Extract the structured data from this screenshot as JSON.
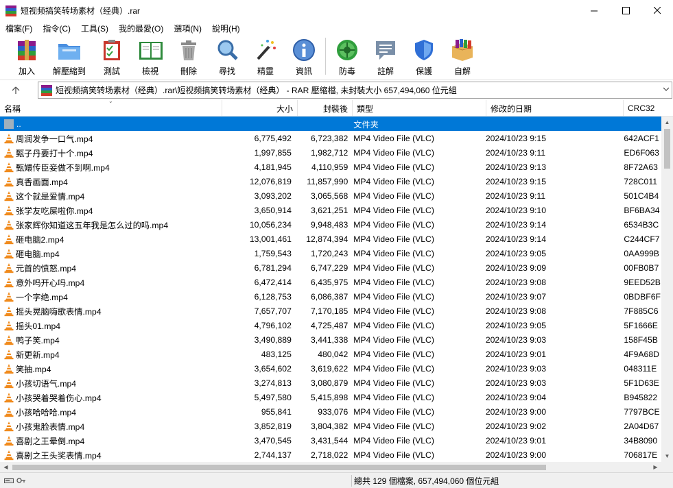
{
  "window": {
    "title": "短视频搞笑转场素材（经典）.rar",
    "minimize": "—",
    "maximize": "☐",
    "close": "✕"
  },
  "menu": [
    "檔案(F)",
    "指令(C)",
    "工具(S)",
    "我的最愛(O)",
    "選項(N)",
    "說明(H)"
  ],
  "toolbar": {
    "add": "加入",
    "extract": "解壓縮到",
    "test": "測試",
    "view": "檢視",
    "delete": "刪除",
    "find": "尋找",
    "wizard": "精靈",
    "info": "資訊",
    "virus": "防毒",
    "comment": "註解",
    "protect": "保護",
    "sfx": "自解"
  },
  "address": {
    "text": "短视频搞笑转场素材（经典）.rar\\短视频搞笑转场素材（经典） - RAR 壓縮檔, 未封裝大小 657,494,060 位元組"
  },
  "columns": {
    "name": "名稱",
    "size": "大小",
    "packed": "封裝後",
    "type": "類型",
    "modified": "修改的日期",
    "crc": "CRC32"
  },
  "parent_row": {
    "name": "..",
    "type": "文件夹"
  },
  "files": [
    {
      "name": "周润发争一口气.mp4",
      "size": "6,775,492",
      "packed": "6,723,382",
      "type": "MP4 Video File (VLC)",
      "date": "2024/10/23 9:15",
      "crc": "642ACF1"
    },
    {
      "name": "甄子丹要打十个.mp4",
      "size": "1,997,855",
      "packed": "1,982,712",
      "type": "MP4 Video File (VLC)",
      "date": "2024/10/23 9:11",
      "crc": "ED6F063"
    },
    {
      "name": "甄嬛传臣妾做不到啊.mp4",
      "size": "4,181,945",
      "packed": "4,110,959",
      "type": "MP4 Video File (VLC)",
      "date": "2024/10/23 9:13",
      "crc": "8F72A63"
    },
    {
      "name": "真香画面.mp4",
      "size": "12,076,819",
      "packed": "11,857,990",
      "type": "MP4 Video File (VLC)",
      "date": "2024/10/23 9:15",
      "crc": "728C011"
    },
    {
      "name": "这个就是爱情.mp4",
      "size": "3,093,202",
      "packed": "3,065,568",
      "type": "MP4 Video File (VLC)",
      "date": "2024/10/23 9:11",
      "crc": "501C4B4"
    },
    {
      "name": "张学友吃屎啦你.mp4",
      "size": "3,650,914",
      "packed": "3,621,251",
      "type": "MP4 Video File (VLC)",
      "date": "2024/10/23 9:10",
      "crc": "BF6BA34"
    },
    {
      "name": "张家辉你知道这五年我是怎么过的吗.mp4",
      "size": "10,056,234",
      "packed": "9,948,483",
      "type": "MP4 Video File (VLC)",
      "date": "2024/10/23 9:14",
      "crc": "6534B3C"
    },
    {
      "name": "砸电脑2.mp4",
      "size": "13,001,461",
      "packed": "12,874,394",
      "type": "MP4 Video File (VLC)",
      "date": "2024/10/23 9:14",
      "crc": "C244CF7"
    },
    {
      "name": "砸电脑.mp4",
      "size": "1,759,543",
      "packed": "1,720,243",
      "type": "MP4 Video File (VLC)",
      "date": "2024/10/23 9:05",
      "crc": "0AA999B"
    },
    {
      "name": "元首的愤怒.mp4",
      "size": "6,781,294",
      "packed": "6,747,229",
      "type": "MP4 Video File (VLC)",
      "date": "2024/10/23 9:09",
      "crc": "00FB0B7"
    },
    {
      "name": "意外吗开心吗.mp4",
      "size": "6,472,414",
      "packed": "6,435,975",
      "type": "MP4 Video File (VLC)",
      "date": "2024/10/23 9:08",
      "crc": "9EED52B"
    },
    {
      "name": "一个字绝.mp4",
      "size": "6,128,753",
      "packed": "6,086,387",
      "type": "MP4 Video File (VLC)",
      "date": "2024/10/23 9:07",
      "crc": "0BDBF6F"
    },
    {
      "name": "摇头晃脑嗨歌表情.mp4",
      "size": "7,657,707",
      "packed": "7,170,185",
      "type": "MP4 Video File (VLC)",
      "date": "2024/10/23 9:08",
      "crc": "7F885C6"
    },
    {
      "name": "摇头01.mp4",
      "size": "4,796,102",
      "packed": "4,725,487",
      "type": "MP4 Video File (VLC)",
      "date": "2024/10/23 9:05",
      "crc": "5F1666E"
    },
    {
      "name": "鸭子笑.mp4",
      "size": "3,490,889",
      "packed": "3,441,338",
      "type": "MP4 Video File (VLC)",
      "date": "2024/10/23 9:03",
      "crc": "158F45B"
    },
    {
      "name": "新更新.mp4",
      "size": "483,125",
      "packed": "480,042",
      "type": "MP4 Video File (VLC)",
      "date": "2024/10/23 9:01",
      "crc": "4F9A68D"
    },
    {
      "name": "笑抽.mp4",
      "size": "3,654,602",
      "packed": "3,619,622",
      "type": "MP4 Video File (VLC)",
      "date": "2024/10/23 9:03",
      "crc": "048311E"
    },
    {
      "name": "小孩切语气.mp4",
      "size": "3,274,813",
      "packed": "3,080,879",
      "type": "MP4 Video File (VLC)",
      "date": "2024/10/23 9:03",
      "crc": "5F1D63E"
    },
    {
      "name": "小孩哭着哭着伤心.mp4",
      "size": "5,497,580",
      "packed": "5,415,898",
      "type": "MP4 Video File (VLC)",
      "date": "2024/10/23 9:04",
      "crc": "B945822"
    },
    {
      "name": "小孩哈哈哈.mp4",
      "size": "955,841",
      "packed": "933,076",
      "type": "MP4 Video File (VLC)",
      "date": "2024/10/23 9:00",
      "crc": "7797BCE"
    },
    {
      "name": "小孩鬼脸表情.mp4",
      "size": "3,852,819",
      "packed": "3,804,382",
      "type": "MP4 Video File (VLC)",
      "date": "2024/10/23 9:02",
      "crc": "2A04D67"
    },
    {
      "name": "喜剧之王晕倒.mp4",
      "size": "3,470,545",
      "packed": "3,431,544",
      "type": "MP4 Video File (VLC)",
      "date": "2024/10/23 9:01",
      "crc": "34B8090"
    },
    {
      "name": "喜剧之王头奖表情.mp4",
      "size": "2,744,137",
      "packed": "2,718,022",
      "type": "MP4 Video File (VLC)",
      "date": "2024/10/23 9:00",
      "crc": "706817E"
    }
  ],
  "status": {
    "summary": "總共 129 個檔案, 657,494,060 個位元組"
  },
  "colors": {
    "selection": "#0078d7",
    "vlc_orange": "#f08a1c"
  }
}
